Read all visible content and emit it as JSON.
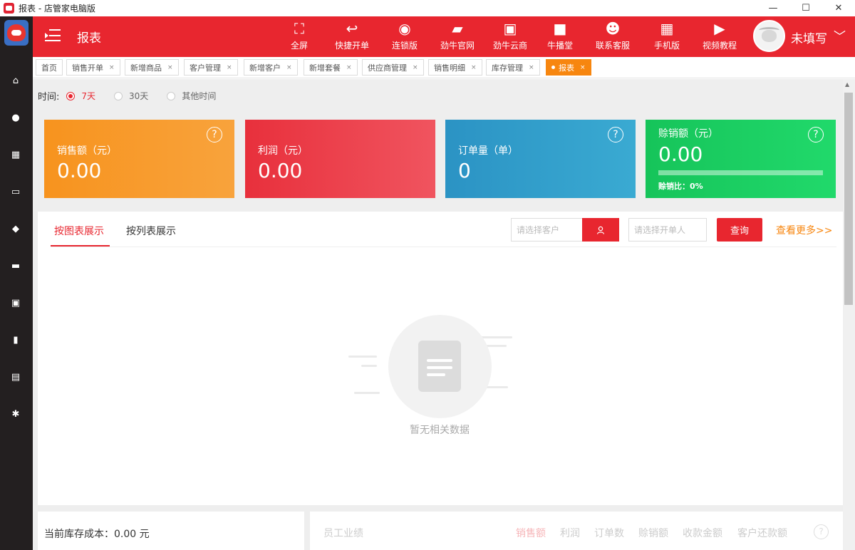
{
  "window": {
    "title": "报表 - 店管家电脑版",
    "minimize": "—",
    "maximize": "☐",
    "close": "✕"
  },
  "header": {
    "page_name": "报表",
    "buttons": [
      {
        "label": "全屏",
        "icon": "fullscreen-icon",
        "glyph": "⛶"
      },
      {
        "label": "快捷开单",
        "icon": "reply-arrow-icon",
        "glyph": "↩"
      },
      {
        "label": "连锁版",
        "icon": "chain-icon",
        "glyph": "◉"
      },
      {
        "label": "劲牛官网",
        "icon": "website-icon",
        "glyph": "▰"
      },
      {
        "label": "劲牛云商",
        "icon": "cloud-shop-icon",
        "glyph": "▣"
      },
      {
        "label": "牛播堂",
        "icon": "video-camera-icon",
        "glyph": "■"
      },
      {
        "label": "联系客服",
        "icon": "customer-service-icon",
        "glyph": "☻"
      },
      {
        "label": "手机版",
        "icon": "qr-code-icon",
        "glyph": "▦"
      },
      {
        "label": "视频教程",
        "icon": "play-icon",
        "glyph": "▶"
      }
    ],
    "user_name": "未填写",
    "caret": "﹀"
  },
  "sidebar": {
    "icons": [
      "home-icon",
      "user-icon",
      "grid-icon",
      "box-icon",
      "tag-icon",
      "truck-icon",
      "store-icon",
      "chart-icon",
      "briefcase-icon",
      "settings-icon"
    ],
    "glyphs": [
      "⌂",
      "●",
      "▦",
      "▭",
      "◆",
      "▬",
      "▣",
      "▮",
      "▤",
      "✱"
    ]
  },
  "tabs": [
    {
      "label": "首页",
      "closable": false
    },
    {
      "label": "销售开单",
      "closable": true
    },
    {
      "label": "新增商品",
      "closable": true
    },
    {
      "label": "客户管理",
      "closable": true
    },
    {
      "label": "新增客户",
      "closable": true
    },
    {
      "label": "新增套餐",
      "closable": true
    },
    {
      "label": "供应商管理",
      "closable": true
    },
    {
      "label": "销售明细",
      "closable": true
    },
    {
      "label": "库存管理",
      "closable": true
    },
    {
      "label": "报表",
      "closable": true,
      "active": true
    }
  ],
  "tab_close": "×",
  "time_filter": {
    "label": "时间:",
    "options": [
      {
        "label": "7天",
        "selected": true
      },
      {
        "label": "30天",
        "selected": false
      },
      {
        "label": "其他时间",
        "selected": false
      }
    ]
  },
  "cards": [
    {
      "title": "销售额（元）",
      "value": "0.00",
      "color_from": "#f7931e",
      "color_to": "#f8a33c",
      "has_help": true
    },
    {
      "title": "利润（元）",
      "value": "0.00",
      "color_from": "#e8303c",
      "color_to": "#f0545f",
      "has_help": false
    },
    {
      "title": "订单量（单）",
      "value": "0",
      "color_from": "#2b93c4",
      "color_to": "#3aaad2",
      "has_help": true
    },
    {
      "title": "赊销额（元）",
      "value": "0.00",
      "color_from": "#16c45a",
      "color_to": "#21d96b",
      "has_help": true,
      "ratio_label": "赊销比：0%",
      "ratio": 0
    }
  ],
  "help_glyph": "?",
  "panel": {
    "tabs": [
      "按图表展示",
      "按列表展示"
    ],
    "active_tab": 0,
    "customer_placeholder": "请选择客户",
    "opener_placeholder": "请选择开单人",
    "query_label": "查询",
    "more_label": "查看更多>>",
    "empty_text": "暂无相关数据"
  },
  "bottom": {
    "stock_cost": "当前库存成本：0.00 元",
    "staff_title": "员工业绩",
    "staff_tabs": [
      "销售额",
      "利润",
      "订单数",
      "赊销额",
      "收款金额",
      "客户还款额"
    ],
    "staff_active": 0
  },
  "colors": {
    "brand_red": "#e8262f",
    "accent_orange": "#f7860f",
    "sidebar_bg": "#231f20"
  }
}
